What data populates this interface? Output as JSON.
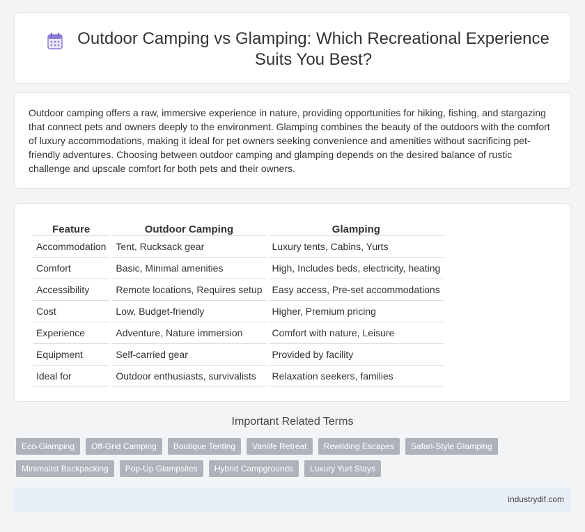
{
  "header": {
    "title": "Outdoor Camping vs Glamping: Which Recreational Experience Suits You Best?",
    "icon": "calendar-icon"
  },
  "intro": {
    "text": "Outdoor camping offers a raw, immersive experience in nature, providing opportunities for hiking, fishing, and stargazing that connect pets and owners deeply to the environment. Glamping combines the beauty of the outdoors with the comfort of luxury accommodations, making it ideal for pet owners seeking convenience and amenities without sacrificing pet-friendly adventures. Choosing between outdoor camping and glamping depends on the desired balance of rustic challenge and upscale comfort for both pets and their owners."
  },
  "table": {
    "headers": [
      "Feature",
      "Outdoor Camping",
      "Glamping"
    ],
    "rows": [
      [
        "Accommodation",
        "Tent, Rucksack gear",
        "Luxury tents, Cabins, Yurts"
      ],
      [
        "Comfort",
        "Basic, Minimal amenities",
        "High, Includes beds, electricity, heating"
      ],
      [
        "Accessibility",
        "Remote locations, Requires setup",
        "Easy access, Pre-set accommodations"
      ],
      [
        "Cost",
        "Low, Budget-friendly",
        "Higher, Premium pricing"
      ],
      [
        "Experience",
        "Adventure, Nature immersion",
        "Comfort with nature, Leisure"
      ],
      [
        "Equipment",
        "Self-carried gear",
        "Provided by facility"
      ],
      [
        "Ideal for",
        "Outdoor enthusiasts, survivalists",
        "Relaxation seekers, families"
      ]
    ]
  },
  "related": {
    "heading": "Important Related Terms",
    "tags": [
      "Eco-Glamping",
      "Off-Grid Camping",
      "Boutique Tenting",
      "Vanlife Retreat",
      "Rewilding Escapes",
      "Safari-Style Glamping",
      "Minimalist Backpacking",
      "Pop-Up Glampsites",
      "Hybrid Campgrounds",
      "Luxury Yurt Stays"
    ]
  },
  "footer": {
    "site": "industrydif.com"
  },
  "colors": {
    "tag_bg": "#aeb3bb",
    "footer_bg": "#e8eef7",
    "icon_accent": "#8a7fd6"
  }
}
